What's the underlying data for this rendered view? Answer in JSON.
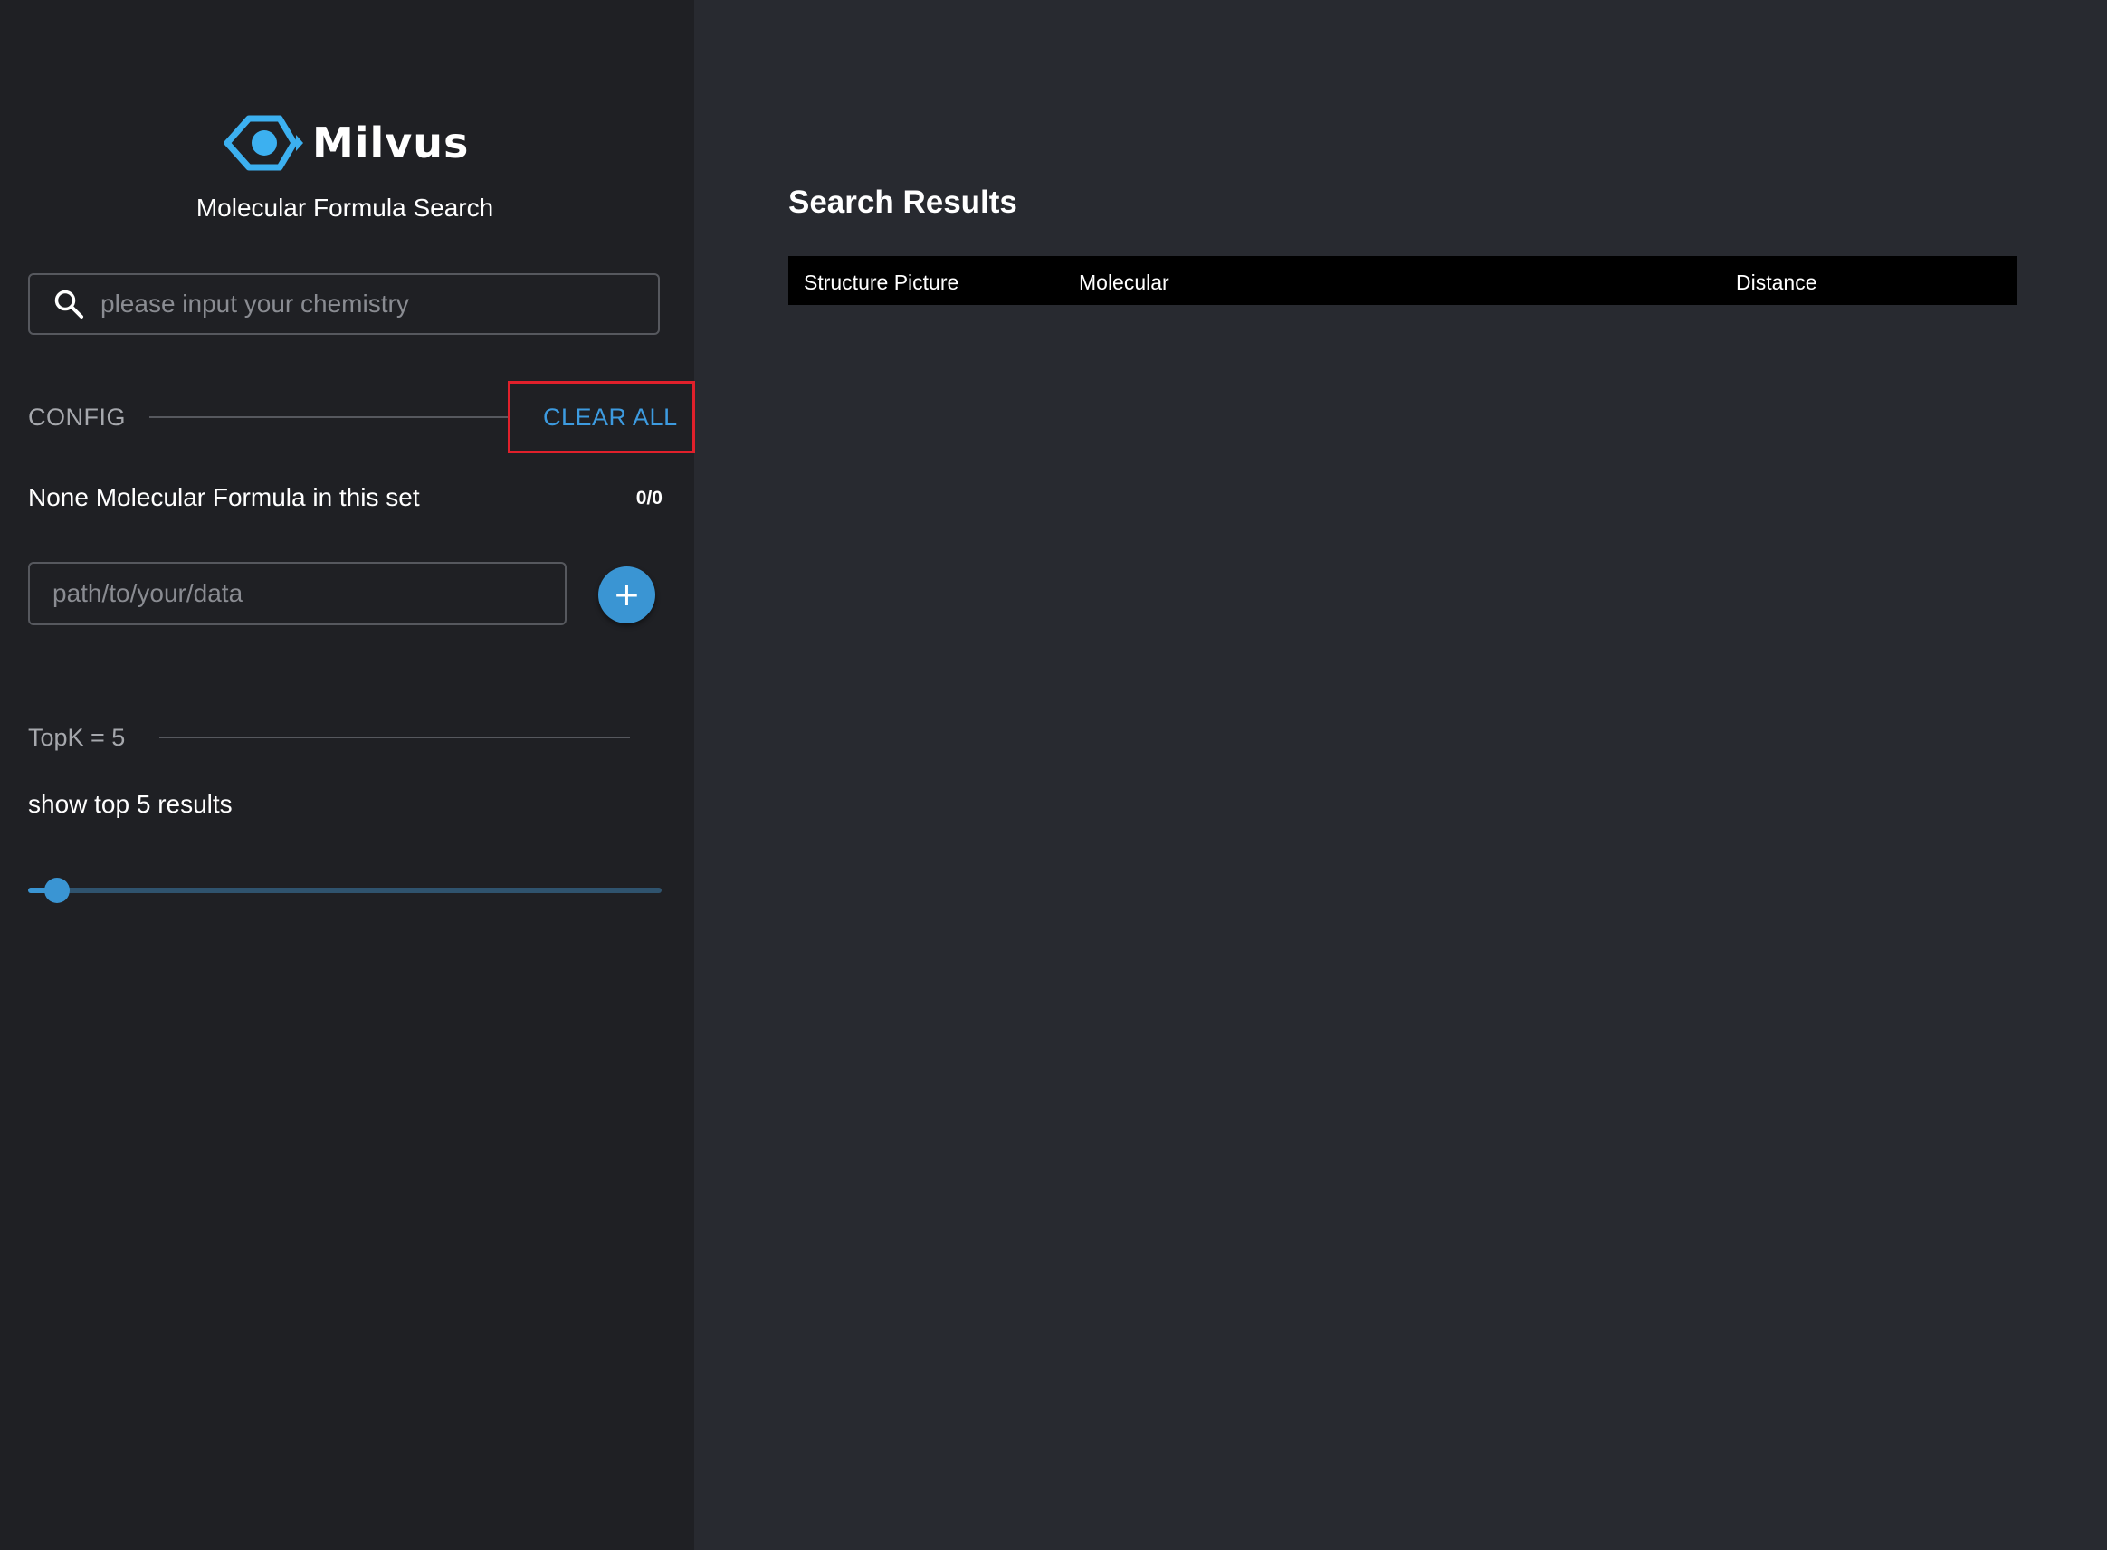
{
  "sidebar": {
    "logo": {
      "icon": "milvus-eye-logo-icon",
      "text": "Milvus",
      "color": "#3cb0f0"
    },
    "subtitle": "Molecular Formula Search",
    "search": {
      "icon": "search-icon",
      "placeholder": "please input your chemistry",
      "value": ""
    },
    "config": {
      "label": "CONFIG",
      "clear_all_label": "CLEAR ALL",
      "set_info": "None Molecular Formula in this set",
      "set_count": "0/0",
      "path_placeholder": "path/to/your/data",
      "path_value": "",
      "add_button": {
        "icon": "plus-icon",
        "label": "+"
      }
    },
    "topk": {
      "label": "TopK = 5",
      "description": "show top 5 results",
      "slider": {
        "value": 5,
        "fraction": 0.045
      }
    }
  },
  "main": {
    "title": "Search Results",
    "table": {
      "columns": [
        "Structure Picture",
        "Molecular",
        "Distance"
      ],
      "rows": []
    }
  },
  "colors": {
    "accent": "#3a95d3",
    "sidebar_bg": "#1f2024",
    "main_bg": "#282a30",
    "highlight_box": "#e0202b"
  }
}
